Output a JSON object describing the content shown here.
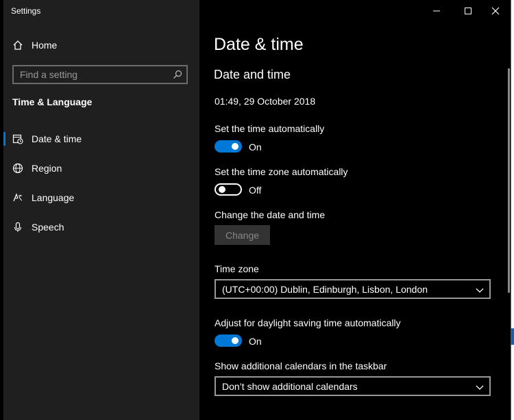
{
  "window": {
    "title": "Settings"
  },
  "sidebar": {
    "home_label": "Home",
    "search_placeholder": "Find a setting",
    "section_title": "Time & Language",
    "items": [
      {
        "label": "Date & time",
        "icon": "calendar-clock-icon",
        "selected": true
      },
      {
        "label": "Region",
        "icon": "globe-icon",
        "selected": false
      },
      {
        "label": "Language",
        "icon": "language-icon",
        "selected": false
      },
      {
        "label": "Speech",
        "icon": "microphone-icon",
        "selected": false
      }
    ]
  },
  "main": {
    "page_title": "Date & time",
    "section_title": "Date and time",
    "current_datetime": "01:49, 29 October 2018",
    "set_time_auto": {
      "label": "Set the time automatically",
      "state": "On"
    },
    "set_timezone_auto": {
      "label": "Set the time zone automatically",
      "state": "Off"
    },
    "change_datetime": {
      "label": "Change the date and time",
      "button": "Change"
    },
    "time_zone": {
      "label": "Time zone",
      "value": "(UTC+00:00) Dublin, Edinburgh, Lisbon, London"
    },
    "daylight_saving": {
      "label": "Adjust for daylight saving time automatically",
      "state": "On"
    },
    "additional_calendars": {
      "label": "Show additional calendars in the taskbar",
      "value": "Don’t show additional calendars"
    }
  },
  "colors": {
    "accent": "#0078d7",
    "sidebar_bg": "#1f1f1f",
    "content_bg": "#000000"
  }
}
